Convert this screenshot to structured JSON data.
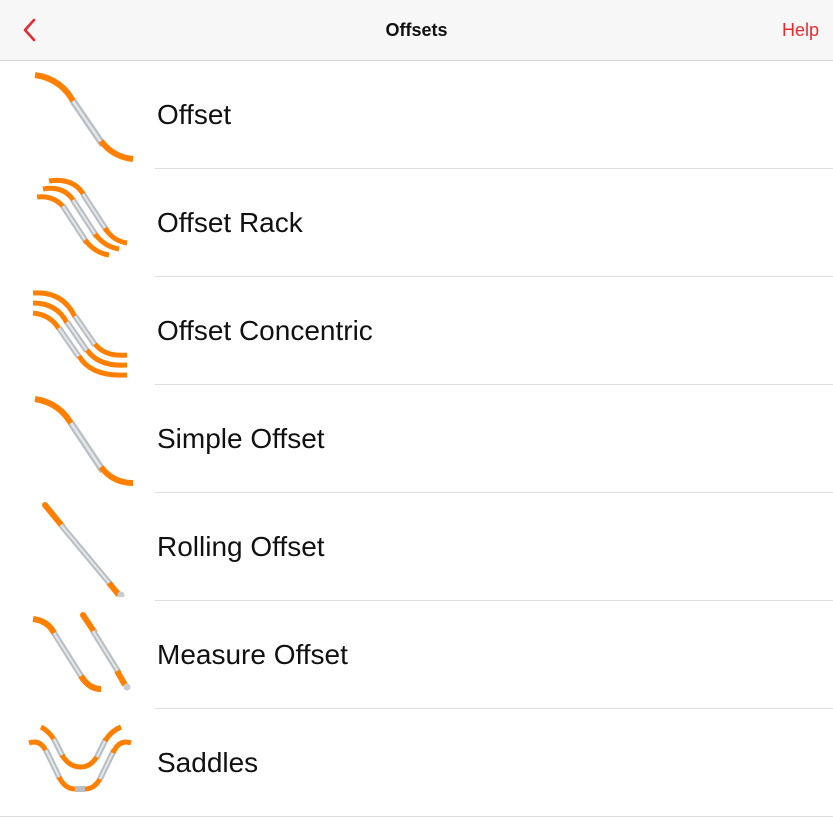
{
  "nav": {
    "title": "Offsets",
    "help_label": "Help"
  },
  "accent": "#e52b2f",
  "pipe_orange": "#ff8000",
  "items": [
    {
      "label": "Offset",
      "icon": "offset-icon"
    },
    {
      "label": "Offset Rack",
      "icon": "offset-rack-icon"
    },
    {
      "label": "Offset Concentric",
      "icon": "offset-concentric-icon"
    },
    {
      "label": "Simple Offset",
      "icon": "simple-offset-icon"
    },
    {
      "label": "Rolling Offset",
      "icon": "rolling-offset-icon"
    },
    {
      "label": "Measure Offset",
      "icon": "measure-offset-icon"
    },
    {
      "label": "Saddles",
      "icon": "saddles-icon"
    }
  ]
}
